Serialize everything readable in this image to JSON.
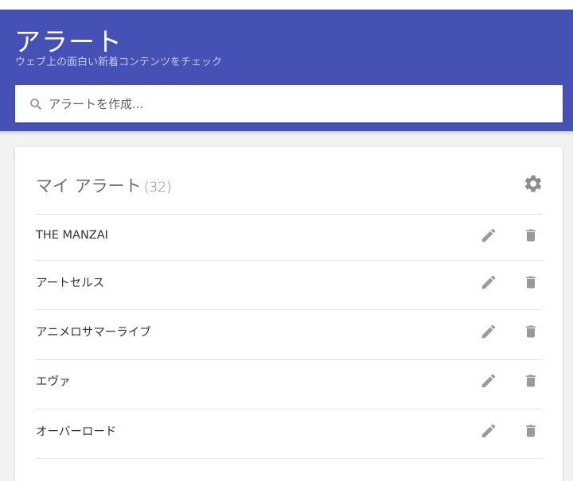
{
  "header": {
    "title": "アラート",
    "subtitle": "ウェブ上の面白い新着コンテンツをチェック",
    "background_color": "#4551b4"
  },
  "search": {
    "icon": "search-icon",
    "placeholder": "アラートを作成..."
  },
  "my_alerts": {
    "title": "マイ アラート",
    "count": "(32)",
    "settings_icon": "gear-icon",
    "items": [
      {
        "label": "THE MANZAI",
        "edit_icon": "pencil-icon",
        "delete_icon": "trash-icon"
      },
      {
        "label": "アートセルス",
        "edit_icon": "pencil-icon",
        "delete_icon": "trash-icon"
      },
      {
        "label": "アニメロサマーライブ",
        "edit_icon": "pencil-icon",
        "delete_icon": "trash-icon"
      },
      {
        "label": "エヴァ",
        "edit_icon": "pencil-icon",
        "delete_icon": "trash-icon"
      },
      {
        "label": "オーバーロード",
        "edit_icon": "pencil-icon",
        "delete_icon": "trash-icon"
      }
    ]
  }
}
